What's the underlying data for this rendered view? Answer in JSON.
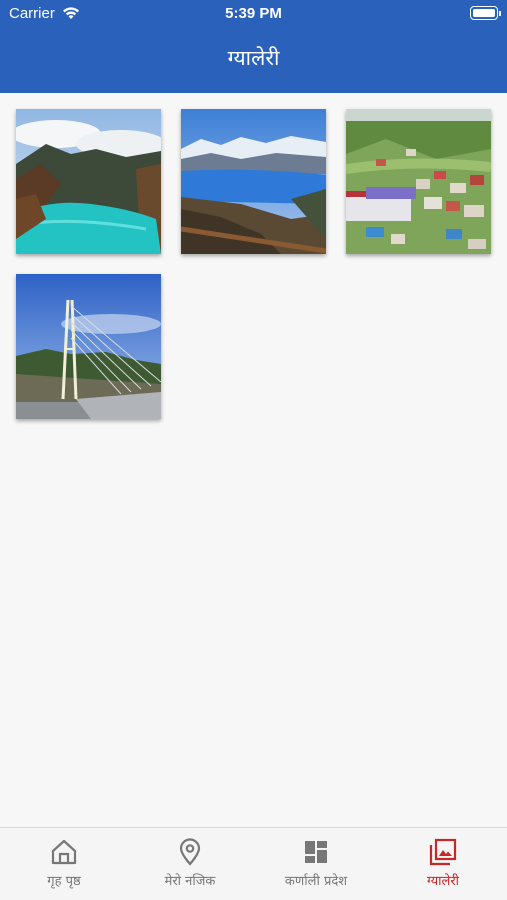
{
  "status_bar": {
    "carrier": "Carrier",
    "time": "5:39 PM"
  },
  "header": {
    "title": "ग्यालेरी"
  },
  "gallery": [
    {
      "name": "lake-turquoise-mountains"
    },
    {
      "name": "lake-blue-snow-peaks"
    },
    {
      "name": "hill-town"
    },
    {
      "name": "suspension-bridge"
    }
  ],
  "tabs": [
    {
      "label": "गृह पृष्ठ",
      "icon": "home-icon",
      "active": false
    },
    {
      "label": "मेरो नजिक",
      "icon": "location-pin-icon",
      "active": false
    },
    {
      "label": "कर्णाली प्रदेश",
      "icon": "dashboard-icon",
      "active": false
    },
    {
      "label": "ग्यालेरी",
      "icon": "gallery-icon",
      "active": true
    }
  ],
  "colors": {
    "app_bar": "#2a62bb",
    "active_tab": "#c62828",
    "inactive_tab": "#777777"
  }
}
